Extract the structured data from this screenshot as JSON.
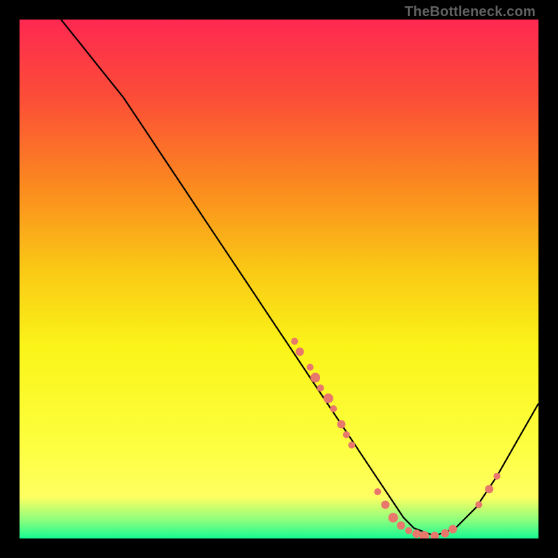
{
  "watermark": "TheBottleneck.com",
  "chart_data": {
    "type": "line",
    "title": "",
    "xlabel": "",
    "ylabel": "",
    "xlim": [
      0,
      100
    ],
    "ylim": [
      0,
      100
    ],
    "grid": false,
    "series": [
      {
        "name": "bottleneck-curve",
        "x": [
          8,
          12,
          16,
          20,
          24,
          28,
          32,
          36,
          40,
          44,
          48,
          52,
          56,
          60,
          64,
          68,
          72,
          74,
          76,
          80,
          84,
          88,
          92,
          96,
          100
        ],
        "y": [
          100,
          95,
          90,
          85,
          79,
          73,
          67,
          61,
          55,
          49,
          43,
          37,
          31,
          25,
          19,
          13,
          7,
          4,
          2,
          0.5,
          2,
          6,
          12,
          19,
          26
        ]
      }
    ],
    "scatter": {
      "name": "data-points",
      "points": [
        {
          "x": 53,
          "y": 38,
          "r": 5
        },
        {
          "x": 54,
          "y": 36,
          "r": 6
        },
        {
          "x": 56,
          "y": 33,
          "r": 5
        },
        {
          "x": 57,
          "y": 31,
          "r": 7
        },
        {
          "x": 58,
          "y": 29,
          "r": 5
        },
        {
          "x": 59.5,
          "y": 27,
          "r": 7
        },
        {
          "x": 60.5,
          "y": 25,
          "r": 5
        },
        {
          "x": 62,
          "y": 22,
          "r": 6
        },
        {
          "x": 63,
          "y": 20,
          "r": 5
        },
        {
          "x": 64,
          "y": 18,
          "r": 5
        },
        {
          "x": 69,
          "y": 9,
          "r": 5
        },
        {
          "x": 70.5,
          "y": 6.5,
          "r": 6
        },
        {
          "x": 72,
          "y": 4,
          "r": 7
        },
        {
          "x": 73.5,
          "y": 2.5,
          "r": 6
        },
        {
          "x": 75,
          "y": 1.5,
          "r": 5
        },
        {
          "x": 76.5,
          "y": 0.9,
          "r": 6
        },
        {
          "x": 78,
          "y": 0.5,
          "r": 7
        },
        {
          "x": 80,
          "y": 0.5,
          "r": 6
        },
        {
          "x": 82,
          "y": 1,
          "r": 6
        },
        {
          "x": 83.5,
          "y": 1.8,
          "r": 6
        },
        {
          "x": 88.5,
          "y": 6.5,
          "r": 5
        },
        {
          "x": 90.5,
          "y": 9.5,
          "r": 6
        },
        {
          "x": 92,
          "y": 12,
          "r": 5
        }
      ],
      "color": "#e8786b"
    },
    "background_gradient": {
      "stops": [
        {
          "offset": 0.0,
          "color": "#fe2850"
        },
        {
          "offset": 0.16,
          "color": "#fc5036"
        },
        {
          "offset": 0.33,
          "color": "#fb8d1e"
        },
        {
          "offset": 0.48,
          "color": "#fac815"
        },
        {
          "offset": 0.63,
          "color": "#faf418"
        },
        {
          "offset": 0.82,
          "color": "#fdff3f"
        },
        {
          "offset": 0.92,
          "color": "#feff61"
        },
        {
          "offset": 0.965,
          "color": "#8bfe7d"
        },
        {
          "offset": 1.0,
          "color": "#17fa93"
        }
      ]
    }
  }
}
